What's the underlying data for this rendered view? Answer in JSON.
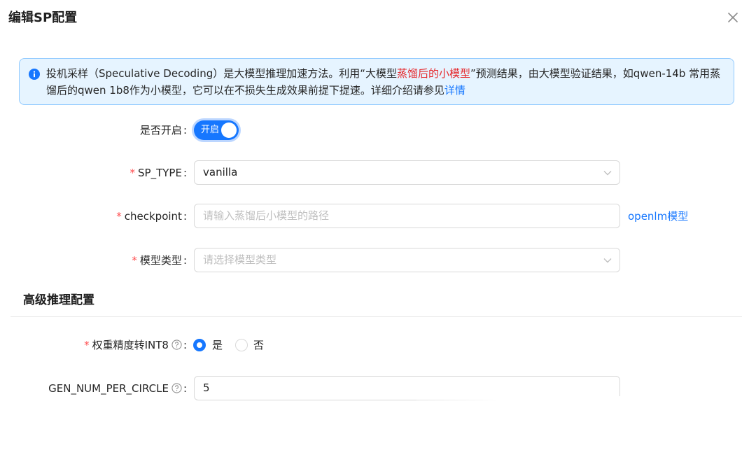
{
  "dialog": {
    "title": "编辑SP配置"
  },
  "alert": {
    "text_before": "投机采样（Speculative Decoding）是大模型推理加速方法。利用“大模型",
    "highlight": "蒸馏后的小模型",
    "text_after": "”预测结果，由大模型验证结果，如qwen-14b 常用蒸馏后的qwen 1b8作为小模型，它可以在不损失生成效果前提下提速。详细介绍请参见",
    "link": "详情",
    "icon": "info-circle-icon"
  },
  "form": {
    "enable": {
      "label": "是否开启",
      "switch_text": "开启",
      "checked": true
    },
    "sp_type": {
      "label": "SP_TYPE",
      "value": "vanilla",
      "required": true
    },
    "checkpoint": {
      "label": "checkpoint",
      "placeholder": "请输入蒸馏后小模型的路径",
      "side_link": "openlm模型",
      "required": true
    },
    "model_type": {
      "label": "模型类型",
      "placeholder": "请选择模型类型",
      "required": true
    }
  },
  "advanced": {
    "title": "高级推理配置",
    "int8": {
      "label": "权重精度转INT8",
      "options": [
        "是",
        "否"
      ],
      "selected": "是",
      "required": true
    },
    "gen_num": {
      "label": "GEN_NUM_PER_CIRCLE",
      "value": "5"
    }
  },
  "colors": {
    "primary": "#1677ff",
    "required": "#ff4d4f",
    "highlight": "#e5262a",
    "alert_bg": "#e6f4ff",
    "alert_border": "#91caff"
  }
}
